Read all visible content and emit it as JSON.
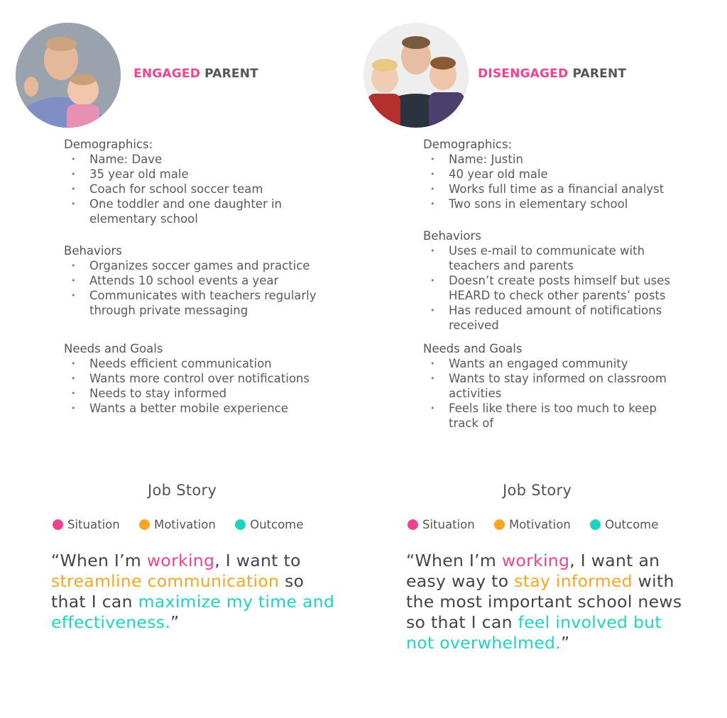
{
  "personas": [
    {
      "title_highlight": "ENGAGED",
      "title_rest": "PARENT",
      "demographics_label": "Demographics:",
      "demographics": [
        "Name: Dave",
        "35 year old male",
        "Coach for school soccer team",
        "One toddler and one daughter in elementary school"
      ],
      "behaviors_label": "Behaviors",
      "behaviors": [
        "Organizes soccer games and practice",
        "Attends 10 school events a year",
        "Communicates with teachers regularly through private messaging"
      ],
      "needs_label": "Needs and Goals",
      "needs": [
        "Needs efficient communication",
        "Wants more control over notifications",
        "Needs to stay informed",
        "Wants a better mobile experience"
      ],
      "job_title": "Job Story",
      "legend": {
        "situation": "Situation",
        "motivation": "Motivation",
        "outcome": "Outcome"
      },
      "quote": {
        "p1": "“When I’m ",
        "situation": "working",
        "p2": ", I want to ",
        "motivation": "streamline communication",
        "p3": " so that I can ",
        "outcome": "maximize my time and effectiveness.",
        "p4": "”"
      }
    },
    {
      "title_highlight": "DISENGAGED",
      "title_rest": "PARENT",
      "demographics_label": "Demographics:",
      "demographics": [
        "Name: Justin",
        "40 year old male",
        "Works full time as a financial analyst",
        "Two sons in elementary school"
      ],
      "behaviors_label": "Behaviors",
      "behaviors": [
        "Uses e-mail to communicate with teachers and parents",
        "Doesn’t create posts himself but uses HEARD to check other parents’ posts",
        "Has reduced amount of notifications received"
      ],
      "needs_label": "Needs and Goals",
      "needs": [
        "Wants an engaged community",
        "Wants to stay informed on classroom activities",
        "Feels like there is too much to keep track of"
      ],
      "job_title": "Job Story",
      "legend": {
        "situation": "Situation",
        "motivation": "Motivation",
        "outcome": "Outcome"
      },
      "quote": {
        "p1": "“When I’m ",
        "situation": "working",
        "p2": ", I want an easy way to ",
        "motivation": "stay informed",
        "p3": " with the most important school news so that I can ",
        "outcome": "feel involved but not overwhelmed.",
        "p4": "”"
      }
    }
  ],
  "colors": {
    "situation": "#ee4490",
    "motivation": "#f5a623",
    "outcome": "#1fd3c0"
  }
}
